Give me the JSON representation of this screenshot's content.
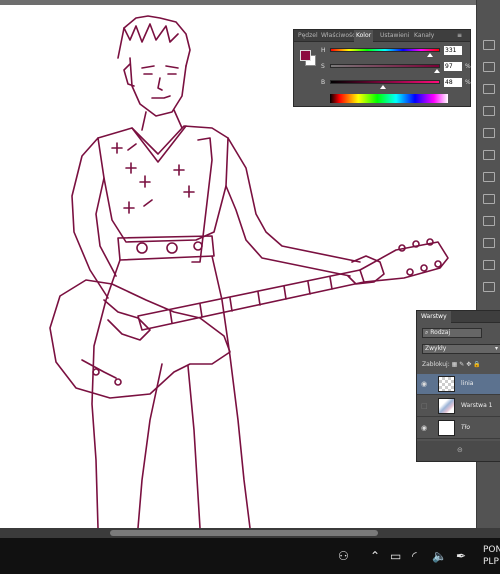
{
  "color_panel": {
    "tabs": [
      "Pędzel",
      "Właściwości",
      "Kolor",
      "Ustawieni",
      "Kanały"
    ],
    "active_tab": "Kolor",
    "foreground_color": "#8c0b3e",
    "background_color": "#ffffff",
    "sliders": [
      {
        "label": "H",
        "value": "331",
        "unit": ""
      },
      {
        "label": "S",
        "value": "97",
        "unit": "%"
      },
      {
        "label": "B",
        "value": "48",
        "unit": "%"
      }
    ]
  },
  "layers_panel": {
    "title": "Warstwy",
    "filter_label": "Rodzaj",
    "blend_mode": "Zwykły",
    "lock_label": "Zablokuj:",
    "layers": [
      {
        "name": "linia",
        "selected": true
      },
      {
        "name": "Warstwa 1",
        "selected": false
      },
      {
        "name": "Tło",
        "selected": false
      }
    ]
  },
  "taskbar": {
    "clock_line1": "PON",
    "clock_line2": "PLP"
  },
  "colors": {
    "sketch_line": "#7a1040",
    "panel_bg": "#535353",
    "selected_layer": "#5c728f"
  }
}
